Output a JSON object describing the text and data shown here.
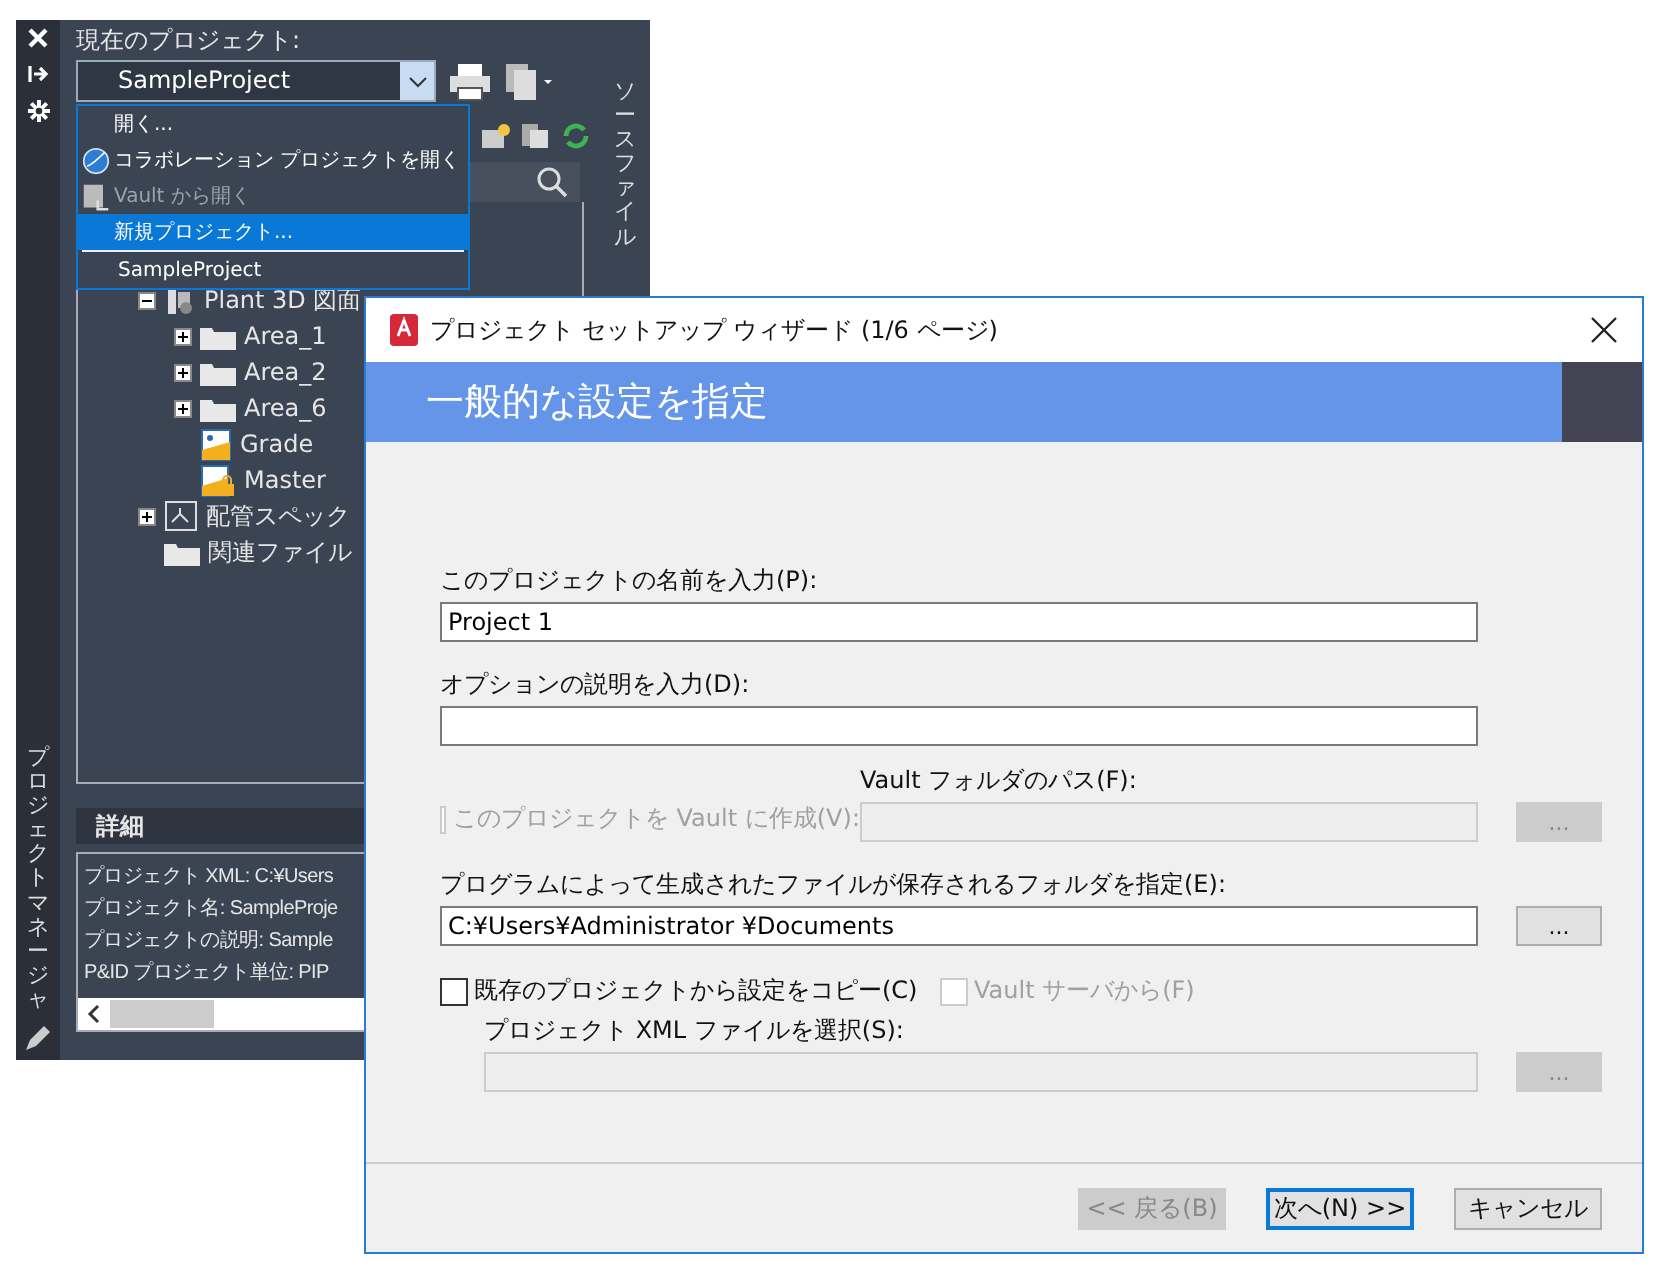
{
  "palette": {
    "side_title": "プロジェクトマネージャ",
    "current_project_label": "現在のプロジェクト:",
    "project_combo": {
      "value": "SampleProject"
    },
    "dropdown": [
      {
        "label": "開く...",
        "kind": "plain",
        "disabled": false,
        "selected": false
      },
      {
        "label": "コラボレーション プロジェクトを開く",
        "kind": "globe",
        "disabled": false,
        "selected": false
      },
      {
        "label": "Vault から開く",
        "kind": "vault",
        "disabled": true,
        "selected": false
      },
      {
        "label": "新規プロジェクト...",
        "kind": "plain",
        "disabled": false,
        "selected": true
      },
      {
        "label": "SampleProject",
        "kind": "recent",
        "disabled": false,
        "selected": false
      }
    ],
    "side_tab": "ソースファイル",
    "tree": [
      {
        "label": "Plant 3D 図面",
        "kind": "plant",
        "expanded": true,
        "children": [
          {
            "label": "Area_1",
            "kind": "folder",
            "expanded": false
          },
          {
            "label": "Area_2",
            "kind": "folder",
            "expanded": false
          },
          {
            "label": "Area_6",
            "kind": "folder",
            "expanded": false
          },
          {
            "label": "Grade",
            "kind": "drawing"
          },
          {
            "label": "Master",
            "kind": "locked"
          }
        ]
      },
      {
        "label": "配管スペック",
        "kind": "spec",
        "expanded": false
      },
      {
        "label": "関連ファイル",
        "kind": "folder"
      }
    ],
    "details": {
      "title": "詳細",
      "lines": [
        "プロジェクト XML: C:¥Users",
        "プロジェクト名: SampleProje",
        "プロジェクトの説明: Sample",
        "P&ID プロジェクト単位: PIP"
      ]
    }
  },
  "dialog": {
    "title": "プロジェクト セットアップ ウィザード (1/6 ページ)",
    "banner": "一般的な設定を指定",
    "name": {
      "label": "このプロジェクトの名前を入力(P):",
      "value": "Project 1"
    },
    "description": {
      "label": "オプションの説明を入力(D):"
    },
    "vault_checkbox": {
      "label": "このプロジェクトを Vault に作成(V):",
      "checked": false,
      "disabled": true
    },
    "vault_path": {
      "label": "Vault フォルダのパス(F):",
      "disabled": true,
      "browse": "..."
    },
    "folder": {
      "label": "プログラムによって生成されたファイルが保存されるフォルダを指定(E):",
      "value": "C:¥Users¥Administrator ¥Documents",
      "disabled": false,
      "browse": "..."
    },
    "copy_checkbox": {
      "label": "既存のプロジェクトから設定をコピー(C)",
      "checked": false,
      "disabled": false
    },
    "vault_server_checkbox": {
      "label": "Vault サーバから(F)",
      "checked": false,
      "disabled": true
    },
    "xml_file": {
      "label": "プロジェクト XML ファイルを選択(S):",
      "disabled": true,
      "browse": "..."
    },
    "buttons": [
      {
        "label": "<< 戻る(B)",
        "disabled": true,
        "default": false
      },
      {
        "label": "次へ(N) >>",
        "disabled": false,
        "default": true
      },
      {
        "label": "キャンセル",
        "disabled": false,
        "default": false
      }
    ]
  }
}
